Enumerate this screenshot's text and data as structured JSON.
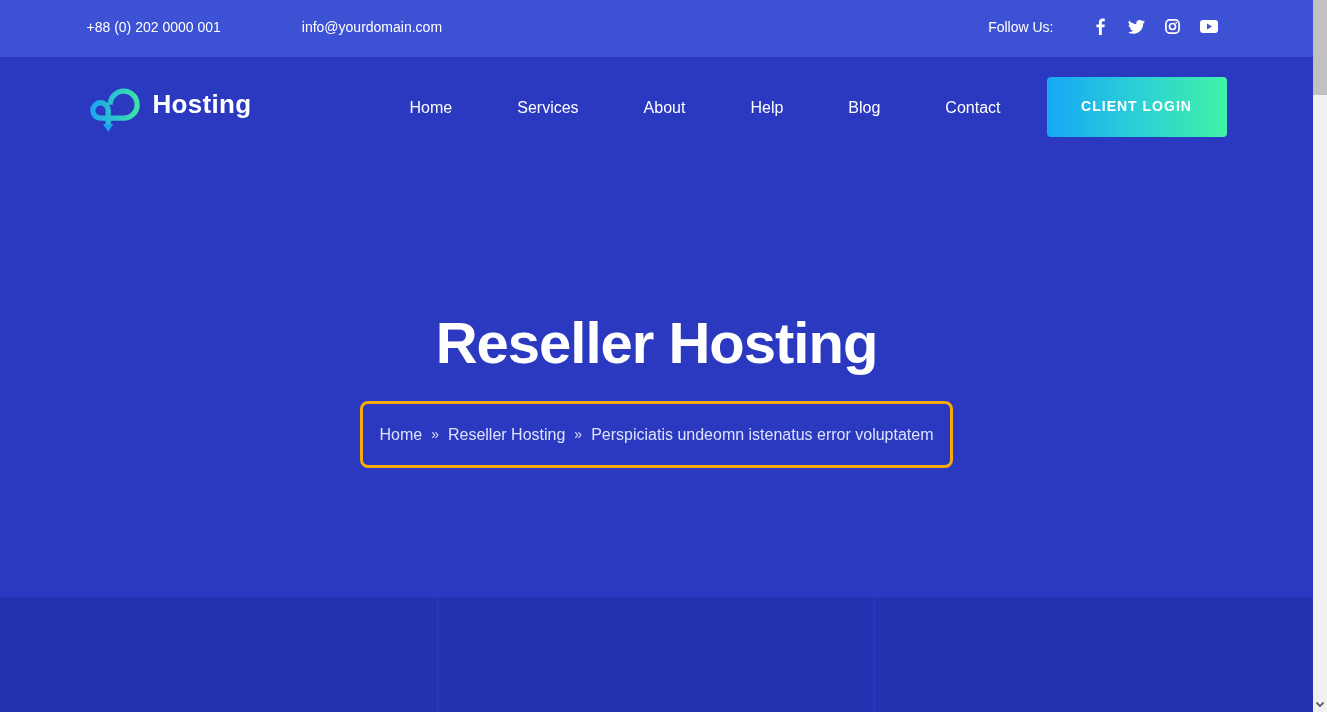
{
  "top_bar": {
    "phone": "+88 (0) 202 0000 001",
    "email": "info@yourdomain.com",
    "follow_label": "Follow Us:"
  },
  "header": {
    "logo_text": "Hosting",
    "nav": [
      "Home",
      "Services",
      "About",
      "Help",
      "Blog",
      "Contact"
    ],
    "login_button": "CLIENT LOGIN"
  },
  "hero": {
    "title": "Reseller Hosting",
    "breadcrumb": [
      {
        "kind": "link",
        "label": "Home"
      },
      {
        "kind": "separator",
        "label": "»"
      },
      {
        "kind": "link",
        "label": "Reseller Hosting"
      },
      {
        "kind": "separator",
        "label": "»"
      },
      {
        "kind": "current",
        "label": "Perspiciatis undeomn istenatus error voluptatem"
      }
    ]
  }
}
